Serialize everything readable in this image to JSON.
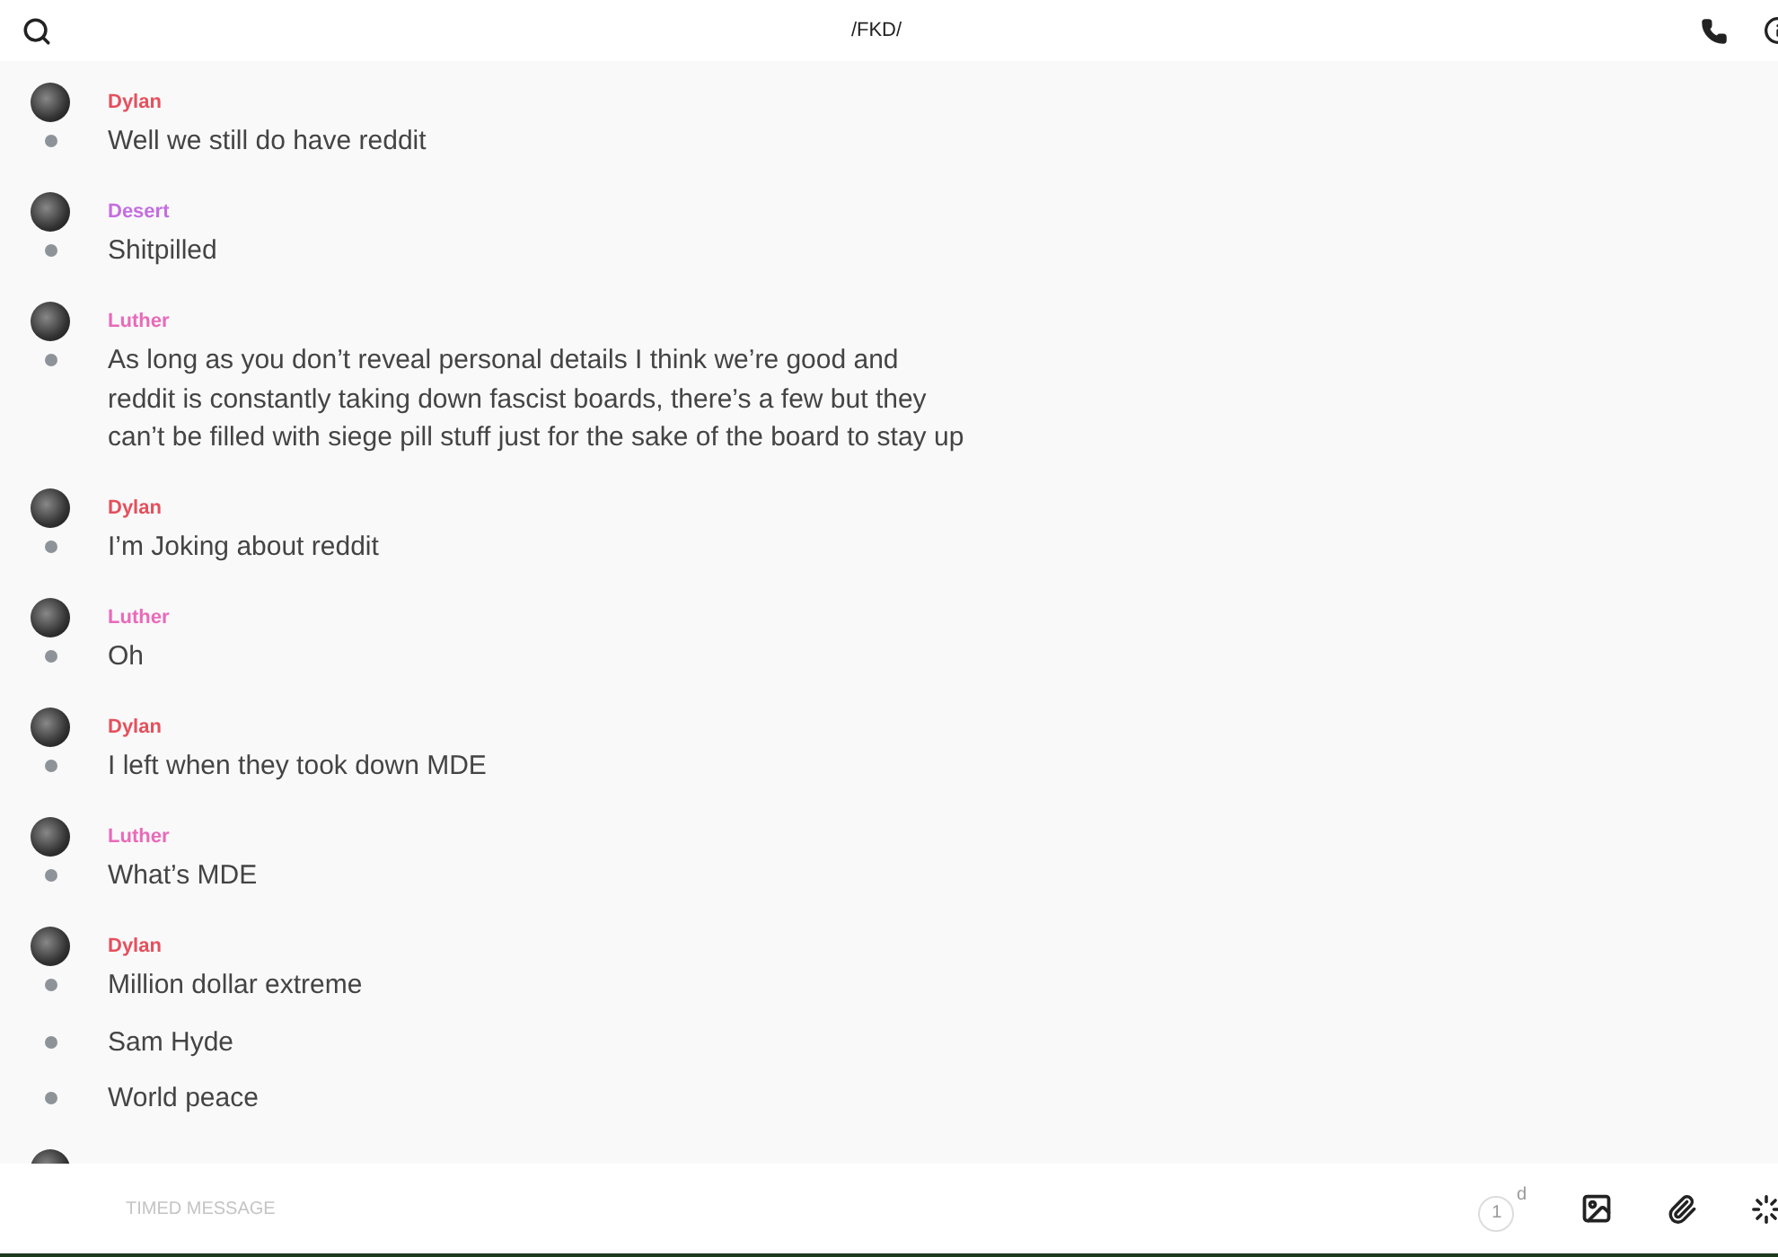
{
  "header": {
    "title": "/FKD/"
  },
  "messages": [
    {
      "author": "Dylan",
      "color": "#e5505c",
      "lines": [
        "Well we still do have reddit"
      ]
    },
    {
      "author": "Desert",
      "color": "#c46ee0",
      "lines": [
        "Shitpilled"
      ]
    },
    {
      "author": "Luther",
      "color": "#e96ab9",
      "lines": [
        "As long as you don’t reveal personal details I think we’re good and reddit is constantly taking down fascist boards, there’s a few but they can’t be filled with siege pill stuff just for the sake of the board to stay up"
      ]
    },
    {
      "author": "Dylan",
      "color": "#e5505c",
      "lines": [
        "I’m Joking about reddit"
      ]
    },
    {
      "author": "Luther",
      "color": "#e96ab9",
      "lines": [
        "Oh"
      ]
    },
    {
      "author": "Dylan",
      "color": "#e5505c",
      "lines": [
        "I left when they took down MDE"
      ]
    },
    {
      "author": "Luther",
      "color": "#e96ab9",
      "lines": [
        "What’s MDE"
      ]
    },
    {
      "author": "Dylan",
      "color": "#e5505c",
      "lines": [
        "Million dollar extreme",
        "Sam Hyde",
        "World peace"
      ]
    },
    {
      "kind": "avatar_only"
    }
  ],
  "composer": {
    "placeholder": "TIMED MESSAGE",
    "timer": {
      "value": "1",
      "unit": "d"
    }
  }
}
